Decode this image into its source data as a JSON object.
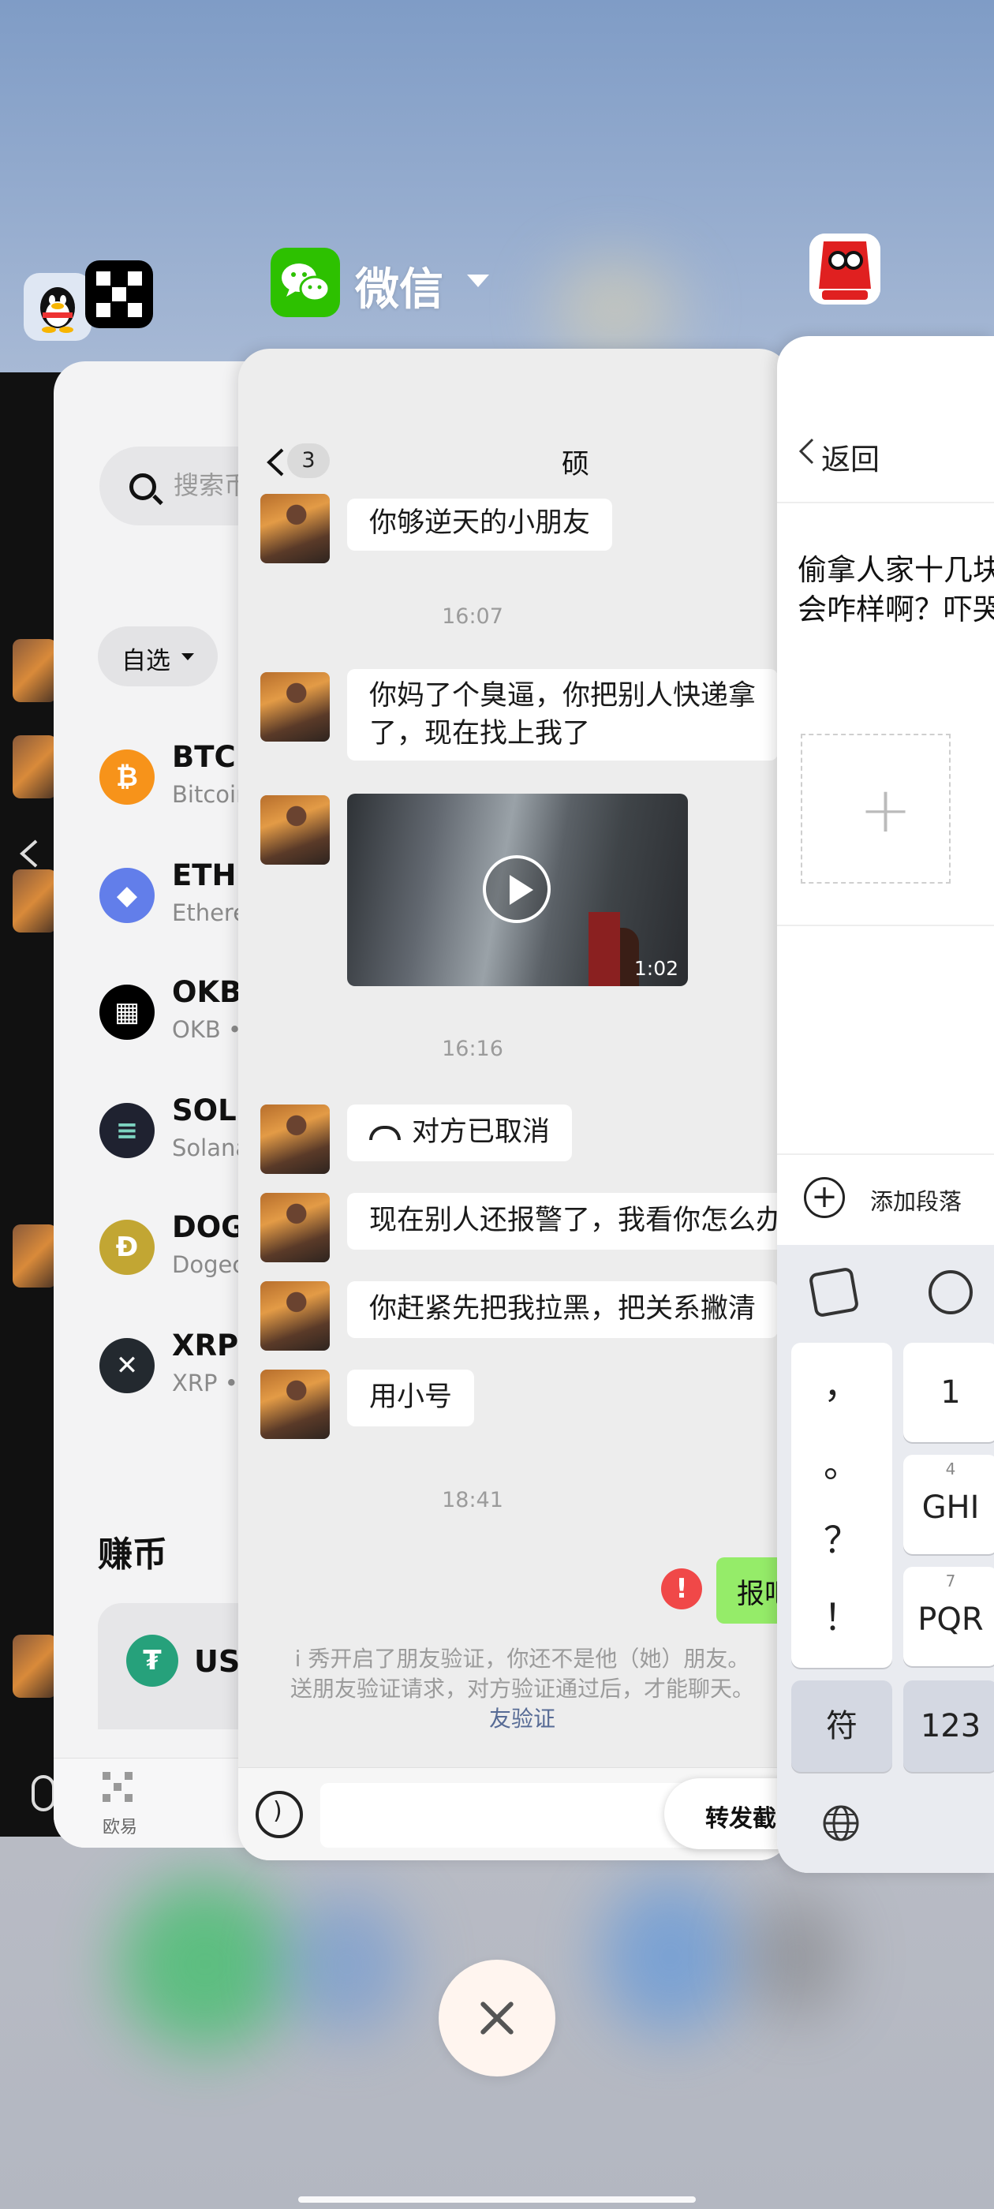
{
  "header": {
    "app_name": "微信"
  },
  "okx": {
    "search_placeholder": "搜索币",
    "filter_chip": "自选",
    "coins": [
      {
        "symbol": "BTC /",
        "name": "Bitcoin",
        "color": "#f7931a",
        "glyph": "₿"
      },
      {
        "symbol": "ETH /",
        "name": "Ethere",
        "color": "#627eea",
        "glyph": "◆"
      },
      {
        "symbol": "OKB",
        "name": "OKB •",
        "color": "#000000",
        "glyph": "▦"
      },
      {
        "symbol": "SOL /",
        "name": "Solana",
        "color": "#1f2230",
        "glyph": "≡"
      },
      {
        "symbol": "DOG",
        "name": "Dogec",
        "color": "#c2a633",
        "glyph": "Ð"
      },
      {
        "symbol": "XRP /",
        "name": "XRP •",
        "color": "#23292f",
        "glyph": "✕"
      }
    ],
    "earn_title": "赚币",
    "earn_asset": "USI",
    "tab_label": "欧易"
  },
  "wechat": {
    "unread_badge": "3",
    "contact_name": "硕",
    "messages": [
      {
        "type": "text",
        "text": "你够逆天的小朋友"
      },
      {
        "type": "time",
        "text": "16:07"
      },
      {
        "type": "text",
        "text": "你妈了个臭逼，你把别人快递拿\n了，现在找上我了"
      },
      {
        "type": "video",
        "duration": "1:02"
      },
      {
        "type": "time",
        "text": "16:16"
      },
      {
        "type": "call",
        "text": "对方已取消"
      },
      {
        "type": "text",
        "text": "现在别人还报警了，我看你怎么办"
      },
      {
        "type": "text",
        "text": "你赶紧先把我拉黑，把关系撇清"
      },
      {
        "type": "text",
        "text": "用小号"
      },
      {
        "type": "time",
        "text": "18:41"
      }
    ],
    "outgoing_text": "报吧",
    "error_mark": "!",
    "notice_line1": "i 秀开启了朋友验证，你还不是他（她）朋友。",
    "notice_line2": "送朋友验证请求，对方验证通过后，才能聊天。",
    "notice_link": "友验证",
    "forward_button": "转发截"
  },
  "kanong": {
    "back_label": "返回",
    "post_text": "偷拿人家十几块\n会咋样啊？吓哭",
    "add_paragraph": "添加段落",
    "keyboard": {
      "punct": [
        "，",
        "。",
        "？",
        "！"
      ],
      "key_1": "1",
      "key_4_num": "4",
      "key_4": "GHI",
      "key_7_num": "7",
      "key_7": "PQR",
      "symbol_key": "符",
      "num_key": "123"
    }
  },
  "colors": {
    "wechat_green": "#2dc100",
    "bubble_green": "#95ec69",
    "link_blue": "#576b95",
    "error_red": "#f04848"
  }
}
